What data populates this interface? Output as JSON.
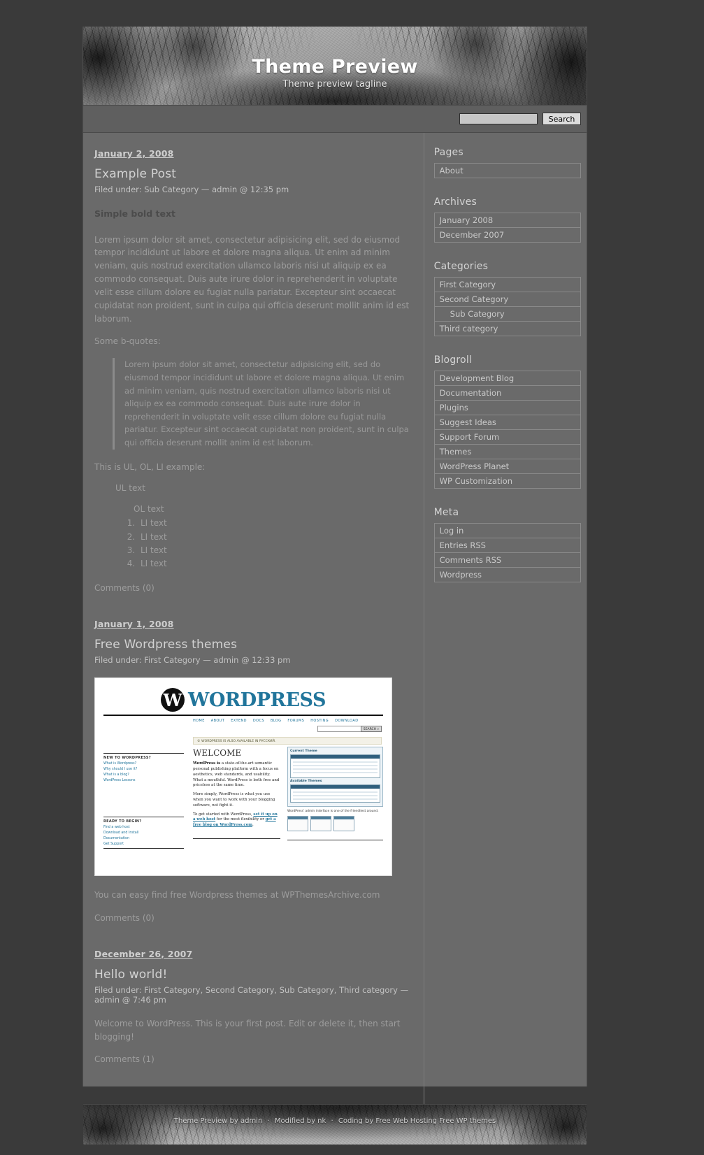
{
  "header": {
    "blog_title": "Theme Preview",
    "blog_description": "Theme preview tagline"
  },
  "search": {
    "value": "",
    "placeholder": "",
    "button_label": "Search"
  },
  "posts": [
    {
      "date": "January 2, 2008",
      "title": "Example Post",
      "meta": "Filed under: Sub Category — admin @ 12:35 pm",
      "bold_lead": "Simple bold text",
      "paragraph_1": "Lorem ipsum dolor sit amet, consectetur adipisicing elit, sed do eiusmod tempor incididunt ut labore et dolore magna aliqua. Ut enim ad minim veniam, quis nostrud exercitation ullamco laboris nisi ut aliquip ex ea commodo consequat. Duis aute irure dolor in reprehenderit in voluptate velit esse cillum dolore eu fugiat nulla pariatur. Excepteur sint occaecat cupidatat non proident, sunt in culpa qui officia deserunt mollit anim id est laborum.",
      "quotes_intro": "Some b-quotes:",
      "blockquote": "Lorem ipsum dolor sit amet, consectetur adipisicing elit, sed do eiusmod tempor incididunt ut labore et dolore magna aliqua. Ut enim ad minim veniam, quis nostrud exercitation ullamco laboris nisi ut aliquip ex ea commodo consequat. Duis aute irure dolor in reprehenderit in voluptate velit esse cillum dolore eu fugiat nulla pariatur. Excepteur sint occaecat cupidatat non proident, sunt in culpa qui officia deserunt mollit anim id est laborum.",
      "lists_intro": "This is UL, OL, LI example:",
      "ul_item": "UL text",
      "ol_label": "OL text",
      "ol_items": [
        "LI text",
        "LI text",
        "LI text",
        "LI text"
      ],
      "comments": "Comments (0)"
    },
    {
      "date": "January 1, 2008",
      "title": "Free Wordpress themes",
      "meta": "Filed under: First Category — admin @ 12:33 pm",
      "caption": "You can easy find free Wordpress themes at WPThemesArchive.com",
      "comments": "Comments (0)"
    },
    {
      "date": "December 26, 2007",
      "title": "Hello world!",
      "meta": "Filed under: First Category, Second Category, Sub Category, Third category — admin @ 7:46 pm",
      "body": "Welcome to WordPress. This is your first post. Edit or delete it, then start blogging!",
      "comments": "Comments (1)"
    }
  ],
  "post_image": {
    "wordmark": "WORDPRESS",
    "logo_letter": "W",
    "nav": [
      "HOME",
      "ABOUT",
      "EXTEND",
      "DOCS",
      "BLOG",
      "FORUMS",
      "HOSTING",
      "DOWNLOAD"
    ],
    "search_button": "SEARCH »",
    "banner": "© WORDPRESS IS ALSO AVAILABLE IN РУССКИЙ.",
    "new_title": "NEW TO WORDPRESS?",
    "new_items": [
      "What is Wordpress?",
      "Why should I use it?",
      "What is a blog?",
      "WordPress Lessons"
    ],
    "ready_title": "READY TO BEGIN?",
    "ready_items": [
      "Find a web host",
      "Download and Install",
      "Documentation",
      "Get Support"
    ],
    "welcome": "WELCOME",
    "para_1_strong": "WordPress is",
    "para_1": " a state-of-the-art semantic personal publishing platform with a focus on aesthetics, web standards, and usability. What a mouthful. WordPress is both free and priceless at the same time.",
    "para_2": "More simply, WordPress is what you use when you want to work with your blogging software, not fight it.",
    "para_3_pre": "To get started with WordPress, ",
    "para_3_link1": "set it up on a web host",
    "para_3_mid": " for the most flexibility or ",
    "para_3_link2": "get a free blog on WordPress.com",
    "para_3_end": ".",
    "panel_1_title": "Current Theme",
    "panel_2_title": "Available Themes",
    "panel_caption": "WordPress' admin interface is one of the friendliest around."
  },
  "sidebar": {
    "widgets": [
      {
        "title": "Pages",
        "items": [
          {
            "label": "About",
            "sub": false
          }
        ]
      },
      {
        "title": "Archives",
        "items": [
          {
            "label": "January 2008",
            "sub": false
          },
          {
            "label": "December 2007",
            "sub": false
          }
        ]
      },
      {
        "title": "Categories",
        "items": [
          {
            "label": "First Category",
            "sub": false
          },
          {
            "label": "Second Category",
            "sub": false
          },
          {
            "label": "Sub Category",
            "sub": true
          },
          {
            "label": "Third category",
            "sub": false
          }
        ]
      },
      {
        "title": "Blogroll",
        "items": [
          {
            "label": "Development Blog",
            "sub": false
          },
          {
            "label": "Documentation",
            "sub": false
          },
          {
            "label": "Plugins",
            "sub": false
          },
          {
            "label": "Suggest Ideas",
            "sub": false
          },
          {
            "label": "Support Forum",
            "sub": false
          },
          {
            "label": "Themes",
            "sub": false
          },
          {
            "label": "WordPress Planet",
            "sub": false
          },
          {
            "label": "WP Customization",
            "sub": false
          }
        ]
      },
      {
        "title": "Meta",
        "items": [
          {
            "label": "Log in",
            "sub": false
          },
          {
            "label": "Entries RSS",
            "sub": false,
            "abbr": "RSS"
          },
          {
            "label": "Comments RSS",
            "sub": false,
            "abbr": "RSS"
          },
          {
            "label": "Wordpress",
            "sub": false
          }
        ]
      }
    ]
  },
  "footer": {
    "part_1": "Theme Preview by admin",
    "part_2": "Modified by nk",
    "part_3": "Coding by",
    "part_4": "Free Web Hosting",
    "part_5": "Free WP themes"
  },
  "colors": {
    "page_background": "#6a6a6a",
    "outer_background": "#3a3a3a",
    "text": "#9d9d9d",
    "heading": "#d2d2d2",
    "border": "#8a8a8a"
  }
}
